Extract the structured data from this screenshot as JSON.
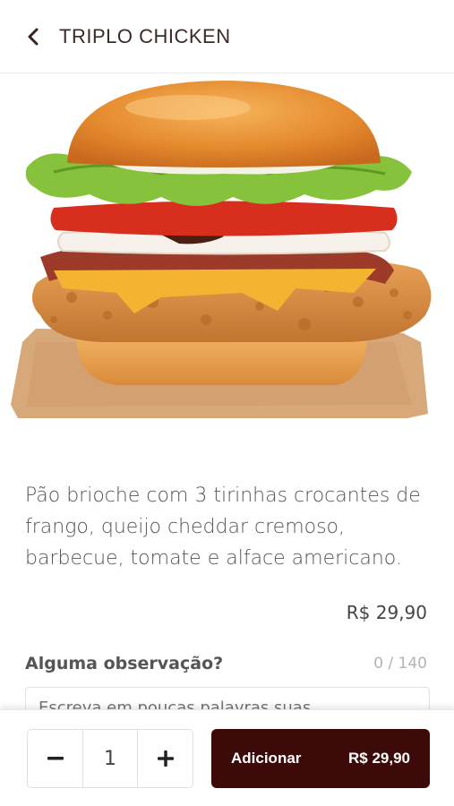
{
  "header": {
    "title": "TRIPLO CHICKEN",
    "back_icon": "chevron-left-icon"
  },
  "product": {
    "image_alt": "burger",
    "description": "Pão brioche com 3 tirinhas crocantes de frango, queijo cheddar cremoso, barbecue, tomate e alface americano.",
    "price": "R$ 29,90"
  },
  "observation": {
    "label": "Alguma observação?",
    "counter": "0 / 140",
    "placeholder": "Escreva em poucas palavras suas..."
  },
  "footer": {
    "quantity": "1",
    "add_label": "Adicionar",
    "add_price": "R$ 29,90"
  },
  "colors": {
    "accent": "#3d0a0a",
    "text": "#555555"
  }
}
